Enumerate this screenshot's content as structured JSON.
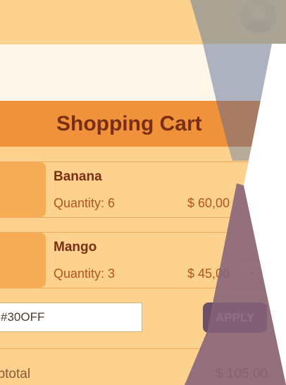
{
  "cart": {
    "title": "Shopping Cart",
    "items": [
      {
        "name": "Banana",
        "quantity_text": "Quantity: 6",
        "price_text": "$ 60,00"
      },
      {
        "name": "Mango",
        "quantity_text": "Quantity: 3",
        "price_text": "$ 45,00",
        "action_text": "-"
      }
    ],
    "coupon": {
      "value": "#30OFF",
      "apply_label": "APPLY"
    },
    "subtotal": {
      "label": "ubtotal",
      "value": "$ 105,00"
    }
  }
}
